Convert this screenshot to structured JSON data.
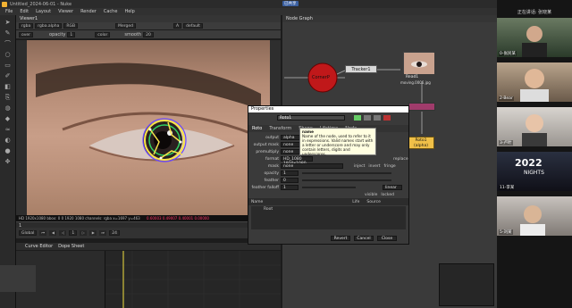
{
  "window": {
    "title": "Untitled_2024-06-01 - Nuke",
    "badge": "已共享"
  },
  "menu": [
    "File",
    "Edit",
    "Layout",
    "Viewer",
    "Render",
    "Cache",
    "Help"
  ],
  "viewer": {
    "tab": "Viewer1",
    "channels": "rgba",
    "alpha": "rgba.alpha",
    "colorspace": "RGB",
    "merge": "Merged",
    "input_a": "A",
    "lut": "default",
    "gain_label": "f/8",
    "gain": "1",
    "gamma_label": "Y",
    "gamma": "1",
    "zoom": "1.1",
    "ratio": "2:1",
    "format": "over",
    "opacity_label": "opacity",
    "opacity": "1",
    "blend": "color",
    "smooth_label": "smooth",
    "smooth": "20",
    "info": "HD 1920x1080  bbox: 0 0 1920 1080  channels: rgba  x=1697 y=463",
    "pixel_values": "0.60003  0.49007  0.40001  0.00000",
    "timeline_start": "1",
    "timeline_end": "100",
    "frame": "1",
    "fps": "24",
    "rate": "Global"
  },
  "curve_tabs": [
    "Curve Editor",
    "Dope Sheet"
  ],
  "node_graph": {
    "tab": "Node Graph",
    "nodes": {
      "cornerpin": "CornerP",
      "tracker": "Tracker1",
      "read": "Read1",
      "read_file": "moving.0006.jpg",
      "roto": "Roto1",
      "roto_sub": "(alpha)"
    }
  },
  "properties": {
    "title": "Properties",
    "node_name": "Roto1",
    "tabs": [
      "Roto",
      "Transform",
      "Shape",
      "Lifetime",
      "Node"
    ],
    "rows": [
      {
        "label": "output",
        "value": "alpha"
      },
      {
        "label": "output mask",
        "value": "none"
      },
      {
        "label": "premultiply",
        "value": "none"
      },
      {
        "label": "format",
        "value": "HD_1080 1920x1080"
      },
      {
        "label": "mask",
        "value": "none"
      },
      {
        "label": "opacity",
        "value": "1"
      },
      {
        "label": "feather",
        "value": "0"
      },
      {
        "label": "feather falloff",
        "value": "1"
      }
    ],
    "extras": {
      "replace": "replace",
      "inject": "inject",
      "invert": "invert",
      "fringe": "fringe",
      "linear": "linear",
      "visible": "visible",
      "locked": "locked"
    },
    "list_headers": [
      "Name",
      "Life",
      "Source"
    ],
    "list_items": [
      "Root"
    ],
    "buttons": {
      "revert": "Revert",
      "cancel": "Cancel",
      "close": "Close"
    }
  },
  "tooltip": {
    "title": "name",
    "body": "Name of the node, used to refer to it in expressions. Valid names start with a letter or underscore and may only contain letters, digits and underscores."
  },
  "participants": {
    "title": "正在讲话: 张晓某",
    "tiles": [
      "0-张民某",
      "2-Bear",
      "3-卢叶",
      "11-李某",
      "5-刘某",
      ""
    ]
  },
  "colors": {
    "accent": "#3a5fa0",
    "cornerpin_node": "#c0181a",
    "roto_node": "#f0c048",
    "tracker_node": "#d8d8d8",
    "rotoshape": "#f7e24a"
  }
}
